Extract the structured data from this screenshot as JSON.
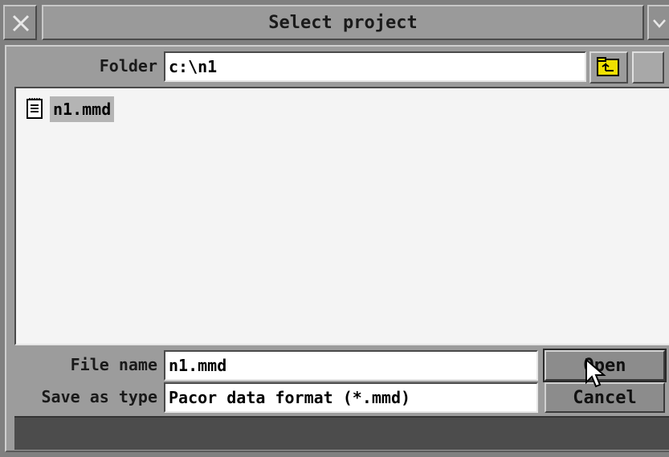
{
  "window": {
    "title": "Select project"
  },
  "folder": {
    "label": "Folder",
    "value": "c:\\n1"
  },
  "files": [
    {
      "name": "n1.mmd",
      "icon": "document-icon",
      "selected": true
    }
  ],
  "file_name": {
    "label": "File name",
    "value": "n1.mmd"
  },
  "save_as_type": {
    "label": "Save as type",
    "value": "Pacor data format (*.mmd)"
  },
  "buttons": {
    "open": "Open",
    "cancel": "Cancel"
  },
  "colors": {
    "chrome": "#808080",
    "panel": "#9c9c9c",
    "field": "#ffffff",
    "list_bg": "#f4f4f4",
    "selection": "#b4b4b4",
    "folder_icon": "#f0e000",
    "status": "#4c4c4c"
  }
}
